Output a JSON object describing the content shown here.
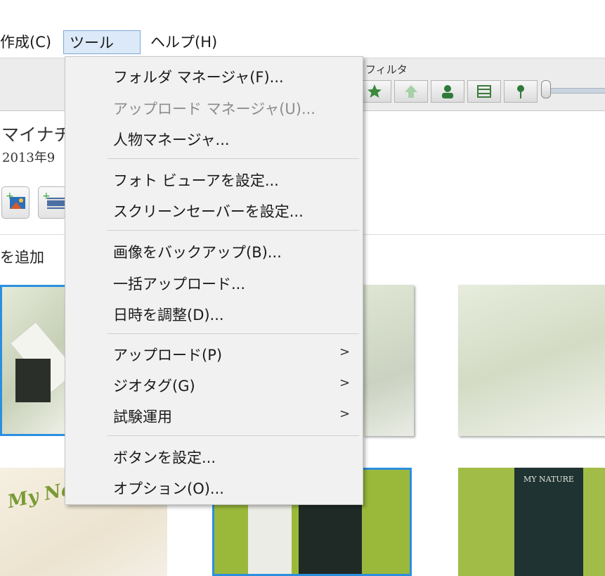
{
  "menubar": {
    "items": [
      {
        "label": "作成(C)"
      },
      {
        "label": "ツール(T)"
      },
      {
        "label": "ヘルプ(H)"
      }
    ]
  },
  "filter_bar": {
    "label": "フィルタ",
    "buttons": [
      "star-icon",
      "up-arrow-icon",
      "person-icon",
      "film-icon",
      "pin-icon"
    ]
  },
  "album": {
    "title": "マイナチ",
    "date": "2013年9",
    "add_label": "を追加"
  },
  "thumbnails": {
    "magazine_text": "My Natur",
    "card_text_top": "MY NATURE"
  },
  "tools_menu": {
    "groups": [
      [
        {
          "label": "フォルダ マネージャ(F)...",
          "disabled": false
        },
        {
          "label": "アップロード マネージャ(U)...",
          "disabled": true
        },
        {
          "label": "人物マネージャ...",
          "disabled": false
        }
      ],
      [
        {
          "label": "フォト ビューアを設定...",
          "disabled": false
        },
        {
          "label": "スクリーンセーバーを設定...",
          "disabled": false
        }
      ],
      [
        {
          "label": "画像をバックアップ(B)...",
          "disabled": false
        },
        {
          "label": "一括アップロード...",
          "disabled": false
        },
        {
          "label": "日時を調整(D)...",
          "disabled": false
        }
      ],
      [
        {
          "label": "アップロード(P)",
          "submenu": ">"
        },
        {
          "label": "ジオタグ(G)",
          "submenu": ">"
        },
        {
          "label": "試験運用",
          "submenu": ">"
        }
      ],
      [
        {
          "label": "ボタンを設定...",
          "disabled": false
        },
        {
          "label": "オプション(O)...",
          "disabled": false
        }
      ]
    ]
  }
}
